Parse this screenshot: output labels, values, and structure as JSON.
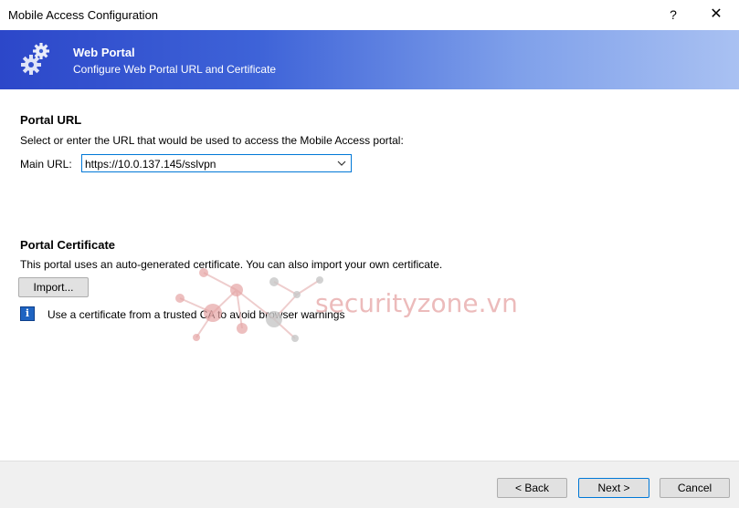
{
  "window": {
    "title": "Mobile Access Configuration",
    "help_label": "?",
    "close_label": "✕"
  },
  "banner": {
    "title": "Web Portal",
    "subtitle": "Configure Web Portal URL and Certificate",
    "icon": "gear-icon"
  },
  "portal_url": {
    "heading": "Portal URL",
    "description": "Select or enter the URL that would be used to access the Mobile Access portal:",
    "main_url_label": "Main URL:",
    "main_url_value": "https://10.0.137.145/sslvpn"
  },
  "portal_certificate": {
    "heading": "Portal Certificate",
    "description": "This portal uses an auto-generated certificate. You can also import your own certificate.",
    "import_label": "Import...",
    "info_text": "Use a certificate from a trusted CA to avoid browser warnings",
    "info_icon": "info-icon"
  },
  "watermark": {
    "text": "securityzone.vn"
  },
  "footer": {
    "back_label": "< Back",
    "next_label": "Next >",
    "cancel_label": "Cancel"
  },
  "colors": {
    "banner_start": "#2c47c9",
    "banner_end": "#a9c1f2",
    "focus_border": "#0078d7",
    "info_icon": "#1f64c2",
    "watermark": "#e6a5a5"
  }
}
